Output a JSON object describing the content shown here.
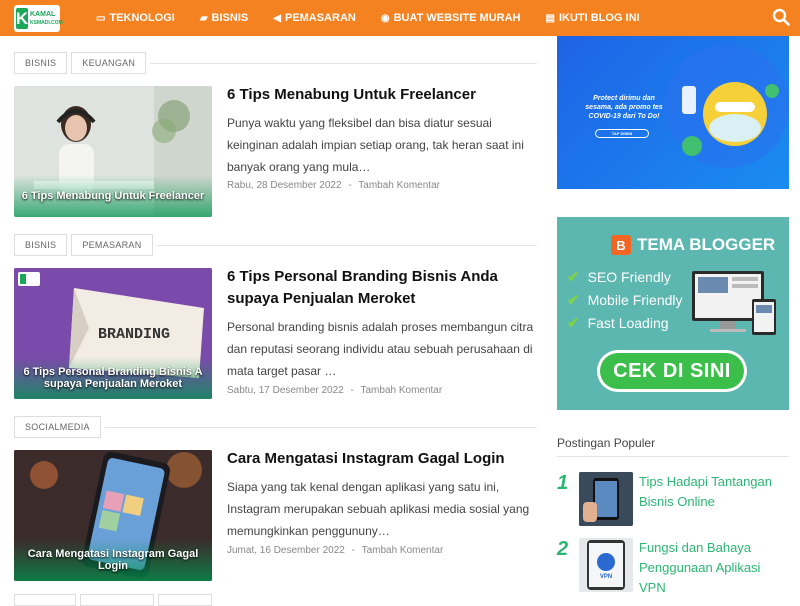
{
  "logo": {
    "letter": "K",
    "line1": "KAMAL",
    "line2": "KSMADI.COM"
  },
  "nav": {
    "items": [
      {
        "label": "TEKNOLOGI",
        "icon": "monitor-icon",
        "glyph": "▭"
      },
      {
        "label": "BISNIS",
        "icon": "briefcase-icon",
        "glyph": "▰"
      },
      {
        "label": "PEMASARAN",
        "icon": "megaphone-icon",
        "glyph": "◀"
      },
      {
        "label": "BUAT WEBSITE MURAH",
        "icon": "globe-icon",
        "glyph": "◉"
      },
      {
        "label": "IKUTI BLOG INI",
        "icon": "rss-icon",
        "glyph": "▤"
      }
    ]
  },
  "posts": [
    {
      "tags": [
        "BISNIS",
        "KEUANGAN"
      ],
      "title": "6 Tips Menabung Untuk Freelancer",
      "excerpt": "Punya waktu yang fleksibel dan bisa diatur sesuai keinginan adalah impian setiap orang, tak heran saat ini banyak orang yang mula…",
      "date": "Rabu, 28 Desember 2022",
      "sep": "-",
      "comment": "Tambah Komentar",
      "thumb_caption": "6 Tips Menabung Untuk Freelancer"
    },
    {
      "tags": [
        "BISNIS",
        "PEMASARAN"
      ],
      "title": "6 Tips Personal Branding Bisnis Anda supaya Penjualan Meroket",
      "excerpt": "Personal branding bisnis adalah proses membangun citra dan reputasi seorang individu atau sebuah perusahaan di mata target pasar …",
      "date": "Sabtu, 17 Desember 2022",
      "sep": "-",
      "comment": "Tambah Komentar",
      "thumb_caption": "6 Tips Personal Branding Bisnis A supaya Penjualan Meroket",
      "thumb_word": "BRANDING"
    },
    {
      "tags": [
        "SOCIALMEDIA"
      ],
      "title": "Cara Mengatasi Instagram Gagal Login",
      "excerpt": "Siapa yang tak kenal dengan aplikasi yang satu ini, Instagram merupakan sebuah aplikasi media sosial yang memungkinkan penggununy…",
      "date": "Jumat, 16 Desember 2022",
      "sep": "-",
      "comment": "Tambah Komentar",
      "thumb_caption": "Cara Mengatasi Instagram Gagal Login"
    }
  ],
  "ad1": {
    "text": "Protect dirimu dan sesama, ada promo tes COVID-19 dari To Do!",
    "button": "TAP DISINI"
  },
  "ad2": {
    "title": "TEMA BLOGGER",
    "logo_letter": "B",
    "features": [
      "SEO Friendly",
      "Mobile Friendly",
      "Fast Loading"
    ],
    "cta": "CEK DI SINI"
  },
  "popular": {
    "heading": "Postingan Populer",
    "items": [
      {
        "num": "1",
        "title": "Tips Hadapi Tantangan Bisnis Online"
      },
      {
        "num": "2",
        "title": "Fungsi dan Bahaya Penggunaan Aplikasi VPN",
        "img_label": "VPN"
      }
    ]
  },
  "colors": {
    "nav": "#f58220",
    "accent": "#2bb673",
    "brand_green": "#1aa85a"
  }
}
